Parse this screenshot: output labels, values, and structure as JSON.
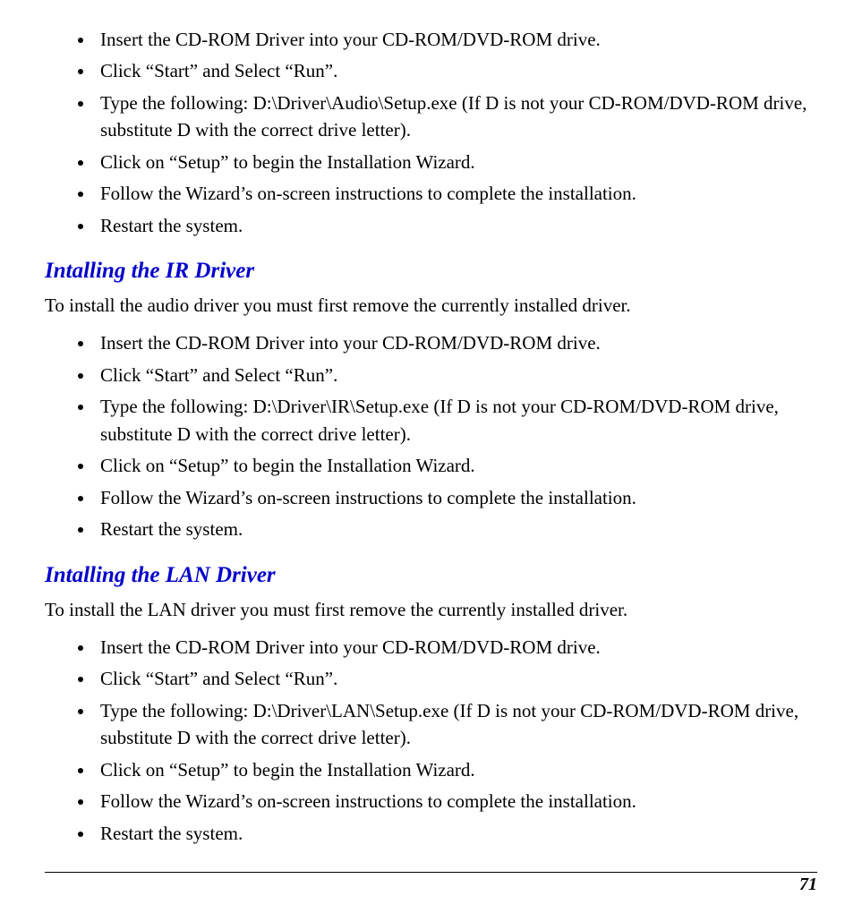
{
  "sections": [
    {
      "heading": null,
      "intro": null,
      "items": [
        "Insert the CD-ROM Driver into your CD-ROM/DVD-ROM drive.",
        "Click “Start” and Select “Run”.",
        "Type the following: D:\\Driver\\Audio\\Setup.exe (If D is not your CD-ROM/DVD-ROM drive, substitute D with the correct drive letter).",
        "Click on “Setup” to begin the Installation Wizard.",
        "Follow the Wizard’s on-screen instructions to complete the installation.",
        "Restart the system."
      ]
    },
    {
      "heading": "Intalling the IR Driver",
      "intro": "To install the audio driver you must first remove the currently installed driver.",
      "items": [
        "Insert the CD-ROM Driver into your CD-ROM/DVD-ROM drive.",
        "Click “Start” and Select “Run”.",
        "Type the following: D:\\Driver\\IR\\Setup.exe (If D is not your CD-ROM/DVD-ROM drive, substitute D with the correct drive letter).",
        "Click on “Setup” to begin the Installation Wizard.",
        "Follow the Wizard’s on-screen instructions to complete the installation.",
        "Restart the system."
      ]
    },
    {
      "heading": "Intalling the LAN Driver",
      "intro": "To install the LAN driver you must first remove the currently installed driver.",
      "items": [
        "Insert the CD-ROM Driver into your CD-ROM/DVD-ROM drive.",
        "Click “Start” and Select “Run”.",
        "Type the following: D:\\Driver\\LAN\\Setup.exe (If D is not your CD-ROM/DVD-ROM drive, substitute D with the correct drive letter).",
        "Click on “Setup” to begin the Installation Wizard.",
        "Follow the Wizard’s on-screen instructions to complete the installation.",
        "Restart the system."
      ]
    }
  ],
  "page_number": "71"
}
